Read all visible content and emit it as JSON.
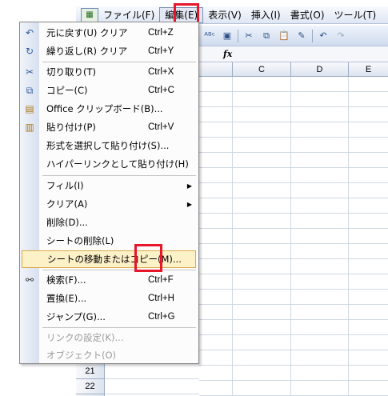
{
  "menubar": {
    "items": [
      {
        "label": "ファイル(F)"
      },
      {
        "label": "編集(E)"
      },
      {
        "label": "表示(V)"
      },
      {
        "label": "挿入(I)"
      },
      {
        "label": "書式(O)"
      },
      {
        "label": "ツール(T)"
      }
    ]
  },
  "toolbar": {
    "icons": [
      "spelling-icon",
      "research-icon",
      "cut-icon",
      "copy-icon",
      "paste-icon",
      "format-painter-icon",
      "undo-icon",
      "redo-icon"
    ]
  },
  "formula_bar": {
    "fx": "fx"
  },
  "sheet": {
    "columns": [
      "C",
      "D",
      "E"
    ],
    "rows": [
      "21",
      "22"
    ]
  },
  "edit_menu": {
    "items": [
      {
        "label": "元に戻す(U) クリア",
        "shortcut": "Ctrl+Z",
        "icon": "undo-icon"
      },
      {
        "label": "繰り返し(R) クリア",
        "shortcut": "Ctrl+Y",
        "icon": "redo-icon"
      },
      {
        "label": "切り取り(T)",
        "shortcut": "Ctrl+X",
        "icon": "cut-icon"
      },
      {
        "label": "コピー(C)",
        "shortcut": "Ctrl+C",
        "icon": "copy-icon"
      },
      {
        "label": "Office クリップボード(B)...",
        "shortcut": "",
        "icon": "clipboard-icon"
      },
      {
        "label": "貼り付け(P)",
        "shortcut": "Ctrl+V",
        "icon": "paste-icon"
      },
      {
        "label": "形式を選択して貼り付け(S)...",
        "shortcut": "",
        "icon": ""
      },
      {
        "label": "ハイパーリンクとして貼り付け(H)",
        "shortcut": "",
        "icon": ""
      },
      {
        "label": "フィル(I)",
        "shortcut": "",
        "icon": "",
        "submenu": true
      },
      {
        "label": "クリア(A)",
        "shortcut": "",
        "icon": "",
        "submenu": true
      },
      {
        "label": "削除(D)...",
        "shortcut": "",
        "icon": ""
      },
      {
        "label": "シートの削除(L)",
        "shortcut": "",
        "icon": ""
      },
      {
        "label": "シートの移動またはコピー(M)...",
        "shortcut": "",
        "icon": "",
        "selected": true
      },
      {
        "label": "検索(F)...",
        "shortcut": "Ctrl+F",
        "icon": "binoculars-icon"
      },
      {
        "label": "置換(E)...",
        "shortcut": "Ctrl+H",
        "icon": ""
      },
      {
        "label": "ジャンプ(G)...",
        "shortcut": "Ctrl+G",
        "icon": ""
      },
      {
        "label": "リンクの設定(K)...",
        "shortcut": "",
        "icon": "",
        "disabled": true
      },
      {
        "label": "オブジェクト(O)",
        "shortcut": "",
        "icon": "",
        "disabled": true
      }
    ]
  },
  "colors": {
    "highlight_box": "#e8162b",
    "selected_item_bg": "#fdf1c8"
  }
}
